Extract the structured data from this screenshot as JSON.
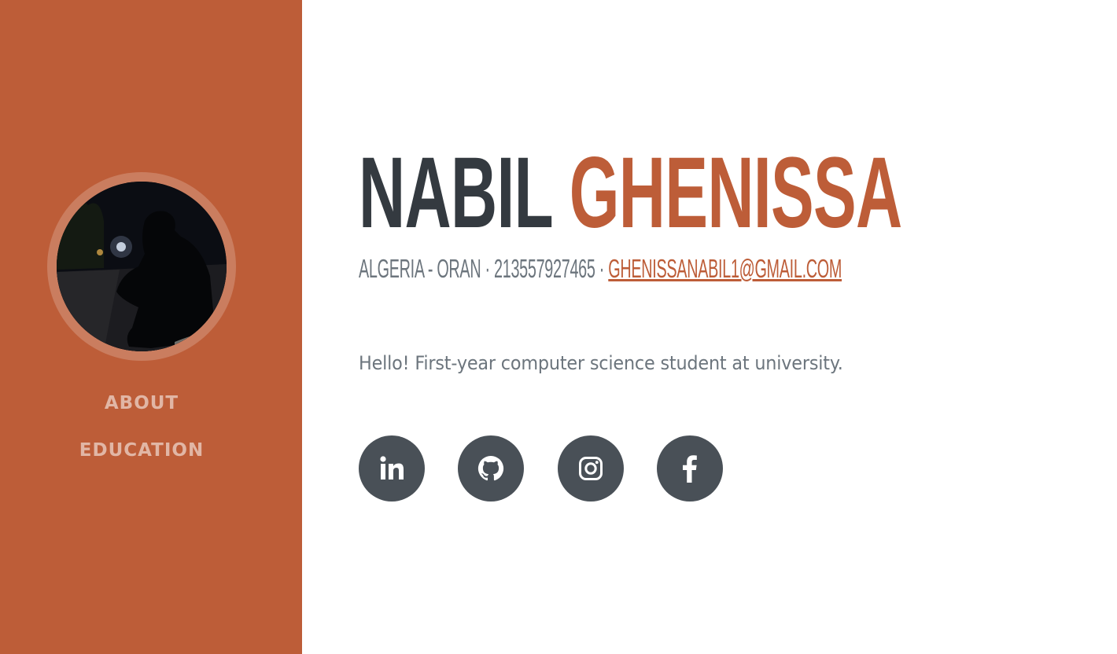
{
  "sidebar": {
    "avatar_alt": "profile photo",
    "nav": [
      {
        "label": "ABOUT"
      },
      {
        "label": "EDUCATION"
      }
    ]
  },
  "header": {
    "first_name": "NABIL",
    "last_name": "GHENISSA"
  },
  "contact": {
    "location": "ALGERIA - ORAN",
    "separator": " · ",
    "phone": "213557927465",
    "email": "GHENISSANABIL1@GMAIL.COM"
  },
  "about": {
    "lead": "Hello! First-year computer science student at university."
  },
  "socials": [
    {
      "icon": "linkedin-icon"
    },
    {
      "icon": "github-icon"
    },
    {
      "icon": "instagram-icon"
    },
    {
      "icon": "facebook-icon"
    }
  ],
  "colors": {
    "primary": "#bd5d38",
    "dark": "#343a40",
    "muted": "#6c757d",
    "social_bg": "#495057"
  }
}
